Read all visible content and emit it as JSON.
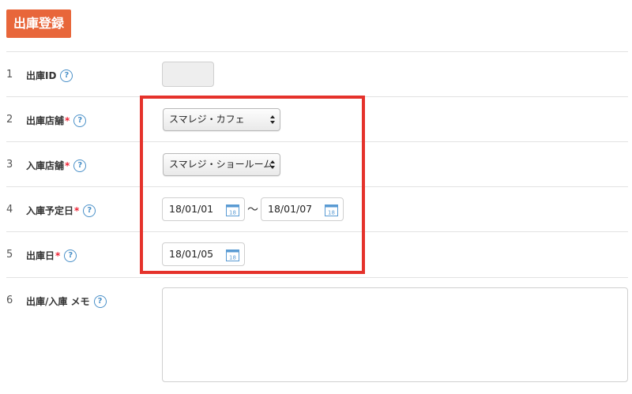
{
  "page": {
    "title": "出庫登録"
  },
  "colors": {
    "title_bg": "#e8663a",
    "highlight": "#e5322b",
    "required": "#ee2233",
    "help": "#4a90c8"
  },
  "rows": [
    {
      "num": "1",
      "label": "出庫ID",
      "required": false
    },
    {
      "num": "2",
      "label": "出庫店舗",
      "required": true,
      "value": "スマレジ・カフェ"
    },
    {
      "num": "3",
      "label": "入庫店舗",
      "required": true,
      "value": "スマレジ・ショールーム"
    },
    {
      "num": "4",
      "label": "入庫予定日",
      "required": true,
      "from": "18/01/01",
      "separator": "～",
      "to": "18/01/07"
    },
    {
      "num": "5",
      "label": "出庫日",
      "required": true,
      "value": "18/01/05"
    },
    {
      "num": "6",
      "label": "出庫/入庫 メモ",
      "required": false
    }
  ],
  "help_symbol": "?",
  "required_mark": "*",
  "calendar_day": "18"
}
